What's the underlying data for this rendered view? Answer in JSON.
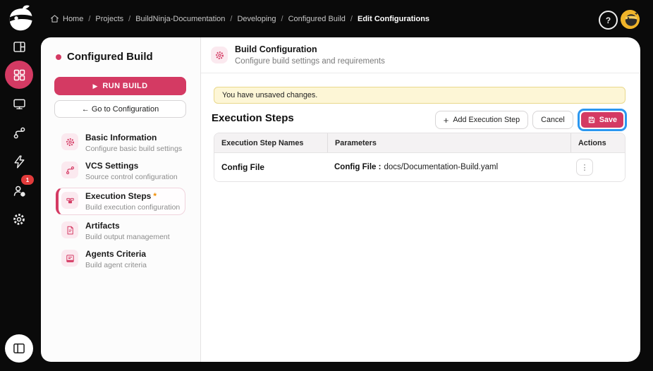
{
  "topbar": {
    "breadcrumb": [
      "Home",
      "Projects",
      "BuildNinja-Documentation",
      "Developing",
      "Configured Build",
      "Edit Configurations"
    ],
    "separator": "/",
    "help_glyph": "?"
  },
  "rail": {
    "badge_count": "1"
  },
  "sidebar": {
    "title": "Configured Build",
    "run_build_label": "RUN BUILD",
    "play_glyph": "▶",
    "goto_label": "← Go to Configuration",
    "items": [
      {
        "title": "Basic Information",
        "subtitle": "Configure basic build settings"
      },
      {
        "title": "VCS Settings",
        "subtitle": "Source control configuration"
      },
      {
        "title": "Execution Steps",
        "subtitle": "Build execution configuration",
        "required_mark": "*"
      },
      {
        "title": "Artifacts",
        "subtitle": "Build output management"
      },
      {
        "title": "Agents Criteria",
        "subtitle": "Build agent criteria"
      }
    ]
  },
  "main": {
    "header": {
      "title": "Build Configuration",
      "subtitle": "Configure build settings and requirements"
    },
    "banner_text": "You have unsaved changes.",
    "section_title": "Execution Steps",
    "buttons": {
      "plus_glyph": "+",
      "add_label": "Add Execution Step",
      "cancel_label": "Cancel",
      "save_label": "Save"
    },
    "table": {
      "columns": [
        "Execution Step Names",
        "Parameters",
        "Actions"
      ],
      "rows": [
        {
          "name": "Config File",
          "param_label": "Config File :",
          "param_value": "docs/Documentation-Build.yaml",
          "actions_glyph": "⋮"
        }
      ]
    }
  },
  "colors": {
    "shell": "#0a0a0a",
    "accent": "#d43a63",
    "focus_ring": "#2b97f0",
    "banner_bg": "#fdf6d6",
    "banner_border": "#e9d88c",
    "badge": "#e23b3b",
    "avatar_bg": "#f0b429"
  }
}
